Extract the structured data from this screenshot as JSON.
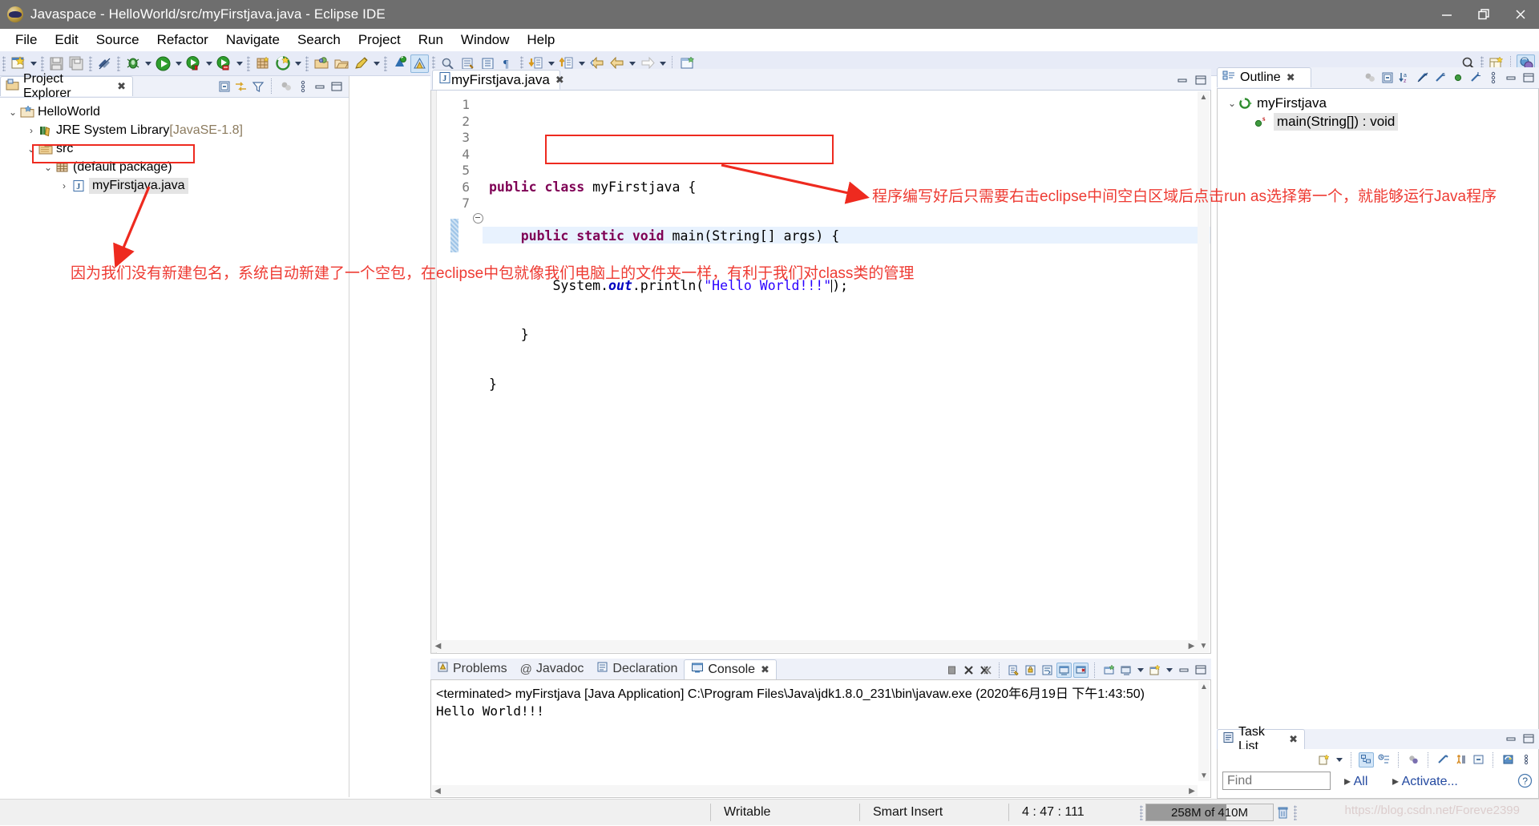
{
  "window": {
    "title": "Javaspace - HelloWorld/src/myFirstjava.java - Eclipse IDE",
    "minimize": "–",
    "restore": "❐",
    "close": "✕"
  },
  "menubar": {
    "items": [
      "File",
      "Edit",
      "Source",
      "Refactor",
      "Navigate",
      "Search",
      "Project",
      "Run",
      "Window",
      "Help"
    ]
  },
  "toolbar": {
    "icons": [
      "new-wizard-icon",
      "new-dropdown-arrow",
      "save-icon",
      "save-all-icon",
      "link-break-icon",
      "debug-icon",
      "debug-dropdown-arrow",
      "run-icon",
      "run-dropdown-arrow",
      "coverage-icon",
      "coverage-dropdown-arrow",
      "external-tools-icon",
      "external-tools-dropdown-arrow",
      "new-java-project-icon",
      "new-package-icon",
      "open-type-icon",
      "new-class-icon",
      "new-annotation-icon",
      "new-annotation-dropdown-arrow",
      "java-perspective-icon",
      "search-icon",
      "open-task-icon",
      "next-annotation-icon",
      "next-annotation-arrow",
      "previous-annotation-icon",
      "previous-annotation-arrow",
      "back-icon",
      "back-dropdown-arrow",
      "forward-icon",
      "forward-dropdown-arrow",
      "new-window-icon"
    ],
    "right_icons": [
      "quick-access-search-icon",
      "open-perspective-icon",
      "java-perspective-active-icon"
    ]
  },
  "project_explorer": {
    "tab_label": "Project Explorer",
    "tab_close": "✖",
    "toolbar_icons": [
      "collapse-all-icon",
      "link-with-editor-icon",
      "view-filter-icon",
      "focus-icon",
      "view-menu-icon",
      "minimize-icon",
      "maximize-icon"
    ],
    "tree": [
      {
        "label": "HelloWorld",
        "suffix": "",
        "depth": 0,
        "twisty": "down",
        "icon": "java-project-icon",
        "selected": false
      },
      {
        "label": "JRE System Library",
        "suffix": " [JavaSE-1.8]",
        "depth": 1,
        "twisty": "right",
        "icon": "library-icon",
        "selected": false
      },
      {
        "label": "src",
        "suffix": "",
        "depth": 1,
        "twisty": "down",
        "icon": "source-folder-icon",
        "selected": false
      },
      {
        "label": "(default package)",
        "suffix": "",
        "depth": 2,
        "twisty": "down",
        "icon": "package-icon",
        "selected": false
      },
      {
        "label": "myFirstjava.java",
        "suffix": "",
        "depth": 3,
        "twisty": "right",
        "icon": "java-file-icon",
        "selected": true
      }
    ]
  },
  "editor": {
    "tab_label": "myFirstjava.java",
    "tab_close": "✖",
    "tab_icon": "java-file-icon",
    "minimize": "–",
    "maximize": "❐",
    "line_numbers": [
      "1",
      "2",
      "3",
      "4",
      "5",
      "6",
      "7"
    ],
    "code_lines": [
      {
        "n": "1",
        "tokens": []
      },
      {
        "n": "2",
        "tokens": [
          {
            "t": "public",
            "c": "kw"
          },
          {
            "t": " ",
            "c": ""
          },
          {
            "t": "class",
            "c": "kw"
          },
          {
            "t": " myFirstjava {",
            "c": ""
          }
        ]
      },
      {
        "n": "3",
        "tokens": [
          {
            "t": "    ",
            "c": ""
          },
          {
            "t": "public",
            "c": "kw"
          },
          {
            "t": " ",
            "c": ""
          },
          {
            "t": "static",
            "c": "kw"
          },
          {
            "t": " ",
            "c": ""
          },
          {
            "t": "void",
            "c": "kw"
          },
          {
            "t": " main(String[] args) {",
            "c": ""
          }
        ]
      },
      {
        "n": "4",
        "tokens": [
          {
            "t": "        System.",
            "c": ""
          },
          {
            "t": "out",
            "c": "fld"
          },
          {
            "t": ".println(",
            "c": ""
          },
          {
            "t": "\"Hello World!!!\"",
            "c": "str"
          },
          {
            "t": ");",
            "c": ""
          }
        ]
      },
      {
        "n": "5",
        "tokens": [
          {
            "t": "    }",
            "c": ""
          }
        ]
      },
      {
        "n": "6",
        "tokens": [
          {
            "t": "}",
            "c": ""
          }
        ]
      },
      {
        "n": "7",
        "tokens": []
      }
    ]
  },
  "outline": {
    "tab_label": "Outline",
    "tab_close": "✖",
    "toolbar_icons": [
      "focus-icon",
      "collapse-all-icon",
      "sort-alphabetically-icon",
      "hide-fields-icon",
      "hide-static-icon",
      "hide-nonpublic-icon",
      "hide-local-types-icon",
      "view-menu-icon",
      "minimize-icon",
      "maximize-icon"
    ],
    "items": [
      {
        "label": "myFirstjava",
        "depth": 0,
        "twisty": "down",
        "icon": "java-class-icon",
        "selected": false
      },
      {
        "label": "main(String[]) : void",
        "depth": 1,
        "twisty": "",
        "icon": "public-static-method-icon",
        "selected": true
      }
    ]
  },
  "console": {
    "tabs": [
      {
        "label": "Problems",
        "icon": "problems-icon",
        "active": false
      },
      {
        "label": "Javadoc",
        "icon": "javadoc-icon",
        "active": false
      },
      {
        "label": "Declaration",
        "icon": "declaration-icon",
        "active": false
      },
      {
        "label": "Console",
        "icon": "console-icon",
        "active": true
      }
    ],
    "tab_close": "✖",
    "toolbar_icons": [
      "terminate-icon",
      "remove-launch-icon",
      "remove-all-terminated-icon",
      "clear-console-icon",
      "scroll-lock-icon",
      "word-wrap-icon",
      "show-console-on-output-icon",
      "pin-console-icon",
      "display-selected-console-icon",
      "display-selected-dropdown-arrow",
      "open-console-icon",
      "open-console-dropdown-arrow",
      "minimize-icon",
      "maximize-icon"
    ],
    "launch_line": "<terminated> myFirstjava [Java Application] C:\\Program Files\\Java\\jdk1.8.0_231\\bin\\javaw.exe (2020年6月19日 下午1:43:50)",
    "output": "Hello World!!!"
  },
  "task_list": {
    "tab_label": "Task List",
    "tab_close": "✖",
    "toolbar_icons": [
      "new-task-icon",
      "new-task-dropdown-arrow",
      "categorized-presentation-icon",
      "scheduled-presentation-icon",
      "focus-on-workweek-icon",
      "collapse-all-icon",
      "filter-completed-icon",
      "restore-icon",
      "synchronize-icon",
      "view-menu-icon",
      "minimize-icon",
      "maximize-icon"
    ],
    "find_placeholder": "Find",
    "all_label": "All",
    "activate_label": "Activate...",
    "help_label": "?"
  },
  "statusbar": {
    "writable": "Writable",
    "insert_mode": "Smart Insert",
    "position": "4 : 47 : 111",
    "heap": "258M of 410M",
    "heap_percent": 63,
    "trash_icon": "trash-icon",
    "watermark": "https://blog.csdn.net/Foreve2399"
  },
  "annotations": {
    "note_editor": "程序编写好后只需要右击eclipse中间空白区域后点击run as选择第一个，就能够运行Java程序",
    "note_package": "因为我们没有新建包名，系统自动新建了一个空包，在eclipse中包就像我们电脑上的文件夹一样，有利于我们对class类的管理"
  },
  "colors": {
    "accent_red": "#ee2a1f",
    "keyword": "#7f0055",
    "string": "#2a00ff",
    "field": "#0000c0",
    "titlebar": "#6e6e6e",
    "toolbar": "#e7ebf7"
  }
}
